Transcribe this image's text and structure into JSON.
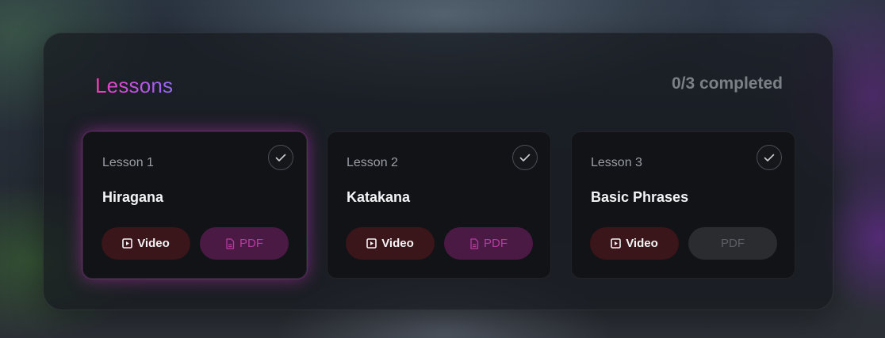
{
  "panel": {
    "title": "Lessons",
    "progress": "0/3 completed"
  },
  "lessons": [
    {
      "number": "Lesson 1",
      "title": "Hiragana",
      "video_label": "Video",
      "pdf_label": "PDF",
      "pdf_available": true,
      "active": true
    },
    {
      "number": "Lesson 2",
      "title": "Katakana",
      "video_label": "Video",
      "pdf_label": "PDF",
      "pdf_available": true,
      "active": false
    },
    {
      "number": "Lesson 3",
      "title": "Basic Phrases",
      "video_label": "Video",
      "pdf_label": "PDF",
      "pdf_available": false,
      "active": false
    }
  ],
  "icons": {
    "complete": "check-icon",
    "video": "play-icon",
    "pdf": "document-icon"
  },
  "colors": {
    "title_gradient_start": "#f23fb3",
    "title_gradient_end": "#8f6cf4",
    "video_button_bg": "#3a1519",
    "pdf_button_bg": "#4a1a45",
    "pdf_button_text": "#b73b9f",
    "active_glow": "#c832be"
  }
}
